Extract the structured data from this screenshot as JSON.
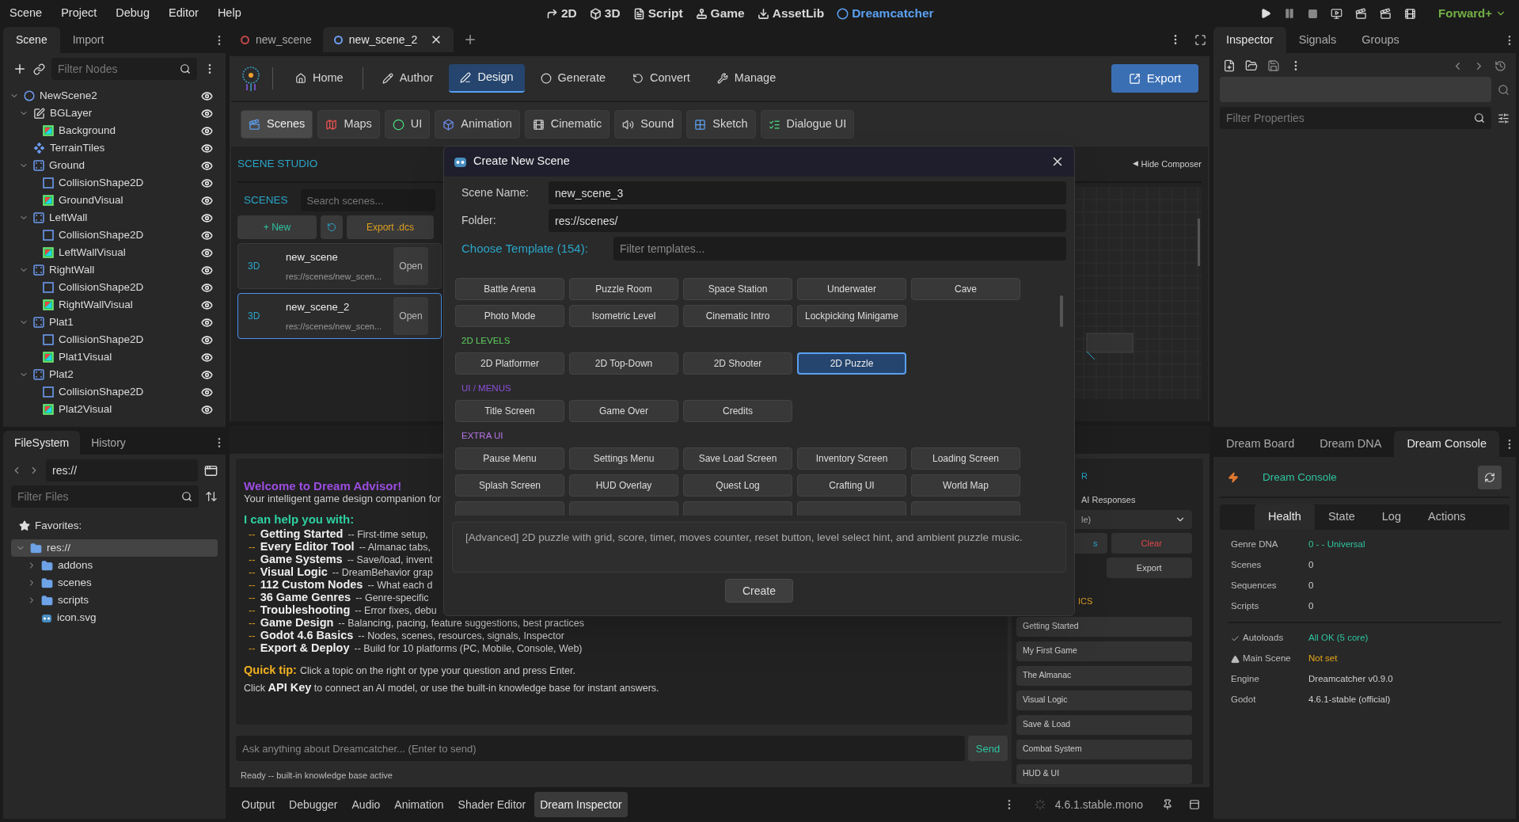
{
  "menu": [
    "Scene",
    "Project",
    "Debug",
    "Editor",
    "Help"
  ],
  "workspaces": [
    {
      "label": "2D",
      "selected": false
    },
    {
      "label": "3D",
      "selected": false
    },
    {
      "label": "Script",
      "selected": false
    },
    {
      "label": "Game",
      "selected": false
    },
    {
      "label": "AssetLib",
      "selected": false
    },
    {
      "label": "Dreamcatcher",
      "selected": true
    }
  ],
  "renderer": "Forward+",
  "scene_dock": {
    "tabs": [
      {
        "label": "Scene",
        "selected": true
      },
      {
        "label": "Import",
        "selected": false
      }
    ],
    "filter_placeholder": "Filter Nodes",
    "tree": [
      {
        "name": "NewScene2",
        "kind": "root",
        "expanded": true,
        "children": [
          {
            "name": "BGLayer",
            "kind": "layer",
            "expanded": true,
            "children": [
              {
                "name": "Background",
                "kind": "sprite"
              }
            ]
          },
          {
            "name": "TerrainTiles",
            "kind": "tilemap"
          },
          {
            "name": "Ground",
            "kind": "body",
            "expanded": true,
            "children": [
              {
                "name": "CollisionShape2D",
                "kind": "shape"
              },
              {
                "name": "GroundVisual",
                "kind": "sprite"
              }
            ]
          },
          {
            "name": "LeftWall",
            "kind": "body",
            "expanded": true,
            "children": [
              {
                "name": "CollisionShape2D",
                "kind": "shape"
              },
              {
                "name": "LeftWallVisual",
                "kind": "sprite"
              }
            ]
          },
          {
            "name": "RightWall",
            "kind": "body",
            "expanded": true,
            "children": [
              {
                "name": "CollisionShape2D",
                "kind": "shape"
              },
              {
                "name": "RightWallVisual",
                "kind": "sprite"
              }
            ]
          },
          {
            "name": "Plat1",
            "kind": "body",
            "expanded": true,
            "children": [
              {
                "name": "CollisionShape2D",
                "kind": "shape"
              },
              {
                "name": "Plat1Visual",
                "kind": "sprite"
              }
            ]
          },
          {
            "name": "Plat2",
            "kind": "body",
            "expanded": true,
            "children": [
              {
                "name": "CollisionShape2D",
                "kind": "shape"
              },
              {
                "name": "Plat2Visual",
                "kind": "sprite"
              }
            ]
          }
        ]
      }
    ]
  },
  "filesystem": {
    "tabs": [
      {
        "label": "FileSystem",
        "selected": true
      },
      {
        "label": "History",
        "selected": false
      }
    ],
    "path": "res://",
    "filter_placeholder": "Filter Files",
    "favorites": "Favorites:",
    "tree": [
      {
        "name": "res://",
        "kind": "folder",
        "selected": true,
        "expanded": true,
        "children": [
          {
            "name": "addons",
            "kind": "folder",
            "selected": false,
            "expanded": false
          },
          {
            "name": "scenes",
            "kind": "folder",
            "selected": false,
            "expanded": false
          },
          {
            "name": "scripts",
            "kind": "folder",
            "selected": false,
            "expanded": false
          },
          {
            "name": "icon.svg",
            "kind": "file",
            "selected": false
          }
        ]
      }
    ]
  },
  "scene_tabs": [
    {
      "label": "new_scene",
      "selected": false,
      "color": "#c24848"
    },
    {
      "label": "new_scene_2",
      "selected": true,
      "color": "#6d9cf0"
    }
  ],
  "dream_tabs": [
    {
      "label": "Home",
      "selected": false
    },
    {
      "label": "Author",
      "selected": false
    },
    {
      "label": "Design",
      "selected": true
    },
    {
      "label": "Generate",
      "selected": false
    },
    {
      "label": "Convert",
      "selected": false
    },
    {
      "label": "Manage",
      "selected": false
    }
  ],
  "export_button": "Export",
  "studio_tools": [
    {
      "label": "Scenes",
      "selected": true
    },
    {
      "label": "Maps",
      "selected": false
    },
    {
      "label": "UI",
      "selected": false
    },
    {
      "label": "Animation",
      "selected": false
    },
    {
      "label": "Cinematic",
      "selected": false
    },
    {
      "label": "Sound",
      "selected": false
    },
    {
      "label": "Sketch",
      "selected": false
    },
    {
      "label": "Dialogue UI",
      "selected": false
    }
  ],
  "studio": {
    "title": "SCENE STUDIO",
    "hide_composer_icon": "◀",
    "hide_composer": "Hide Composer",
    "scenes_label": "SCENES",
    "search_placeholder": "Search scenes...",
    "new_button": "+ New",
    "export_dcs": "Export .dcs",
    "scenes": [
      {
        "type": "3D",
        "name": "new_scene",
        "path": "res://scenes/new_scen...",
        "selected": false,
        "open": "Open"
      },
      {
        "type": "3D",
        "name": "new_scene_2",
        "path": "res://scenes/new_scen...",
        "selected": true,
        "open": "Open"
      }
    ]
  },
  "dialog": {
    "title": "Create New Scene",
    "scene_name_label": "Scene Name:",
    "scene_name": "new_scene_3",
    "folder_label": "Folder:",
    "folder": "res://scenes/",
    "template_label": "Choose Template (154):",
    "filter_placeholder": "Filter templates...",
    "groups": [
      {
        "templates": [
          {
            "label": "Battle Arena",
            "selected": false
          },
          {
            "label": "Puzzle Room",
            "selected": false
          },
          {
            "label": "Space Station",
            "selected": false
          },
          {
            "label": "Underwater",
            "selected": false
          },
          {
            "label": "Cave",
            "selected": false
          },
          {
            "label": "Photo Mode",
            "selected": false
          },
          {
            "label": "Isometric Level",
            "selected": false
          },
          {
            "label": "Cinematic Intro",
            "selected": false
          },
          {
            "label": "Lockpicking Minigame",
            "selected": false
          }
        ]
      },
      {
        "title": "2D LEVELS",
        "color": "#5fd05f",
        "templates": [
          {
            "label": "2D Platformer",
            "selected": false
          },
          {
            "label": "2D Top-Down",
            "selected": false
          },
          {
            "label": "2D Shooter",
            "selected": false
          },
          {
            "label": "2D Puzzle",
            "selected": true
          }
        ]
      },
      {
        "title": "UI / MENUS",
        "color": "#8a4fd8",
        "templates": [
          {
            "label": "Title Screen",
            "selected": false
          },
          {
            "label": "Game Over",
            "selected": false
          },
          {
            "label": "Credits",
            "selected": false
          }
        ]
      },
      {
        "title": "EXTRA UI",
        "color": "#b574e6",
        "templates": [
          {
            "label": "Pause Menu",
            "selected": false
          },
          {
            "label": "Settings Menu",
            "selected": false
          },
          {
            "label": "Save Load Screen",
            "selected": false
          },
          {
            "label": "Inventory Screen",
            "selected": false
          },
          {
            "label": "Loading Screen",
            "selected": false
          },
          {
            "label": "Splash Screen",
            "selected": false
          },
          {
            "label": "HUD Overlay",
            "selected": false
          },
          {
            "label": "Quest Log",
            "selected": false
          },
          {
            "label": "Crafting UI",
            "selected": false
          },
          {
            "label": "World Map",
            "selected": false
          }
        ]
      }
    ],
    "description": "[Advanced] 2D puzzle with grid, score, timer, moves counter, reset button, level select hint, and ambient puzzle music.",
    "create_button": "Create"
  },
  "advisor": {
    "welcome": "Welcome to Dream Advisor!",
    "subtitle": "Your intelligent game design companion for",
    "help_title": "I can help you with:",
    "topics": [
      {
        "bullet": "--",
        "title": "Getting Started",
        "desc": "-- First-time setup,"
      },
      {
        "bullet": "--",
        "title": "Every Editor Tool",
        "desc": "-- Almanac tabs,"
      },
      {
        "bullet": "--",
        "title": "Game Systems",
        "desc": "-- Save/load, invent"
      },
      {
        "bullet": "--",
        "title": "Visual Logic",
        "desc": "-- DreamBehavior grap"
      },
      {
        "bullet": "--",
        "title": "112 Custom Nodes",
        "desc": "-- What each d"
      },
      {
        "bullet": "--",
        "title": "36 Game Genres",
        "desc": "-- Genre-specific"
      },
      {
        "bullet": "--",
        "title": "Troubleshooting",
        "desc": "-- Error fixes, debu"
      },
      {
        "bullet": "--",
        "title": "Game Design",
        "desc": "-- Balancing, pacing, feature suggestions, best practices"
      },
      {
        "bullet": "--",
        "title": "Godot 4.6 Basics",
        "desc": "-- Nodes, scenes, resources, signals, Inspector"
      },
      {
        "bullet": "--",
        "title": "Export & Deploy",
        "desc": "-- Build for 10 platforms (PC, Mobile, Console, Web)"
      }
    ],
    "tip_label": "Quick tip:",
    "tip": "Click a topic on the right or type your question and press Enter.",
    "api_line": "Click **API Key** to connect an AI model, or use the built-in knowledge base for instant answers.",
    "input_placeholder": "Ask anything about Dreamcatcher... (Enter to send)",
    "send": "Send",
    "status": "Ready -- built-in knowledge base active",
    "side": {
      "header_fragment": "R",
      "ai_responses": "AI Responses",
      "dropdown_fragment": "le)",
      "button_fragment": "s",
      "clear": "Clear",
      "export": "Export",
      "section_fragment": "ICS",
      "topics": [
        "Getting Started",
        "My First Game",
        "The Almanac",
        "Visual Logic",
        "Save & Load",
        "Combat System",
        "HUD & UI"
      ]
    }
  },
  "bottom_tabs": [
    {
      "label": "Output",
      "selected": false
    },
    {
      "label": "Debugger",
      "selected": false
    },
    {
      "label": "Audio",
      "selected": false
    },
    {
      "label": "Animation",
      "selected": false
    },
    {
      "label": "Shader Editor",
      "selected": false
    },
    {
      "label": "Dream Inspector",
      "selected": true
    }
  ],
  "version": "4.6.1.stable.mono",
  "inspector": {
    "tabs": [
      {
        "label": "Inspector",
        "selected": true
      },
      {
        "label": "Signals",
        "selected": false
      },
      {
        "label": "Groups",
        "selected": false
      }
    ],
    "filter_placeholder": "Filter Properties"
  },
  "dream_dock": {
    "tabs": [
      {
        "label": "Dream Board",
        "selected": false
      },
      {
        "label": "Dream DNA",
        "selected": false
      },
      {
        "label": "Dream Console",
        "selected": true
      }
    ],
    "title": "Dream Console",
    "subtabs": [
      {
        "label": "Health",
        "selected": true
      },
      {
        "label": "State",
        "selected": false
      },
      {
        "label": "Log",
        "selected": false
      },
      {
        "label": "Actions",
        "selected": false
      }
    ],
    "stats": [
      {
        "label": "Genre DNA",
        "value": "0 - - Universal",
        "color": "#2ec4a0"
      },
      {
        "label": "Scenes",
        "value": "0"
      },
      {
        "label": "Sequences",
        "value": "0"
      },
      {
        "label": "Scripts",
        "value": "0"
      }
    ],
    "checks": [
      {
        "kind": "ok",
        "label": "Autoloads",
        "value": "All OK (5 core)",
        "color": "#2ec4a0"
      },
      {
        "kind": "warn",
        "label": "Main Scene",
        "value": "Not set",
        "color": "#e6a817"
      },
      {
        "kind": "info",
        "label": "Engine",
        "value": "Dreamcatcher v0.9.0"
      },
      {
        "kind": "info",
        "label": "Godot",
        "value": "4.6.1-stable (official)"
      }
    ]
  }
}
